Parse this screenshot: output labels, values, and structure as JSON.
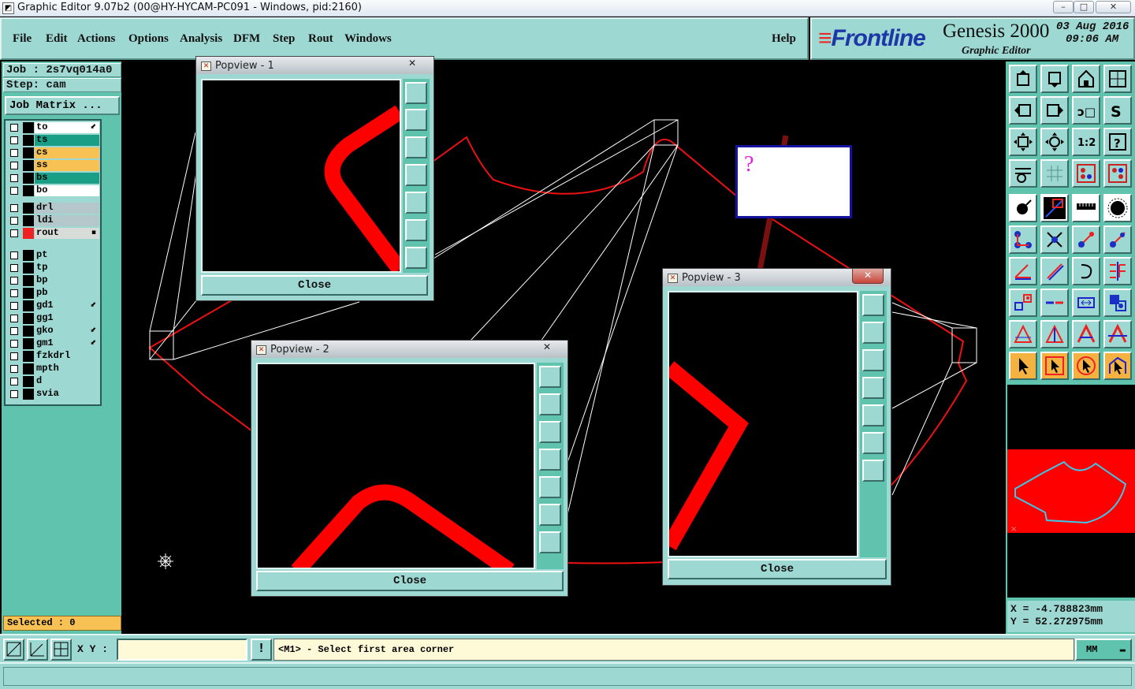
{
  "window": {
    "title": "Graphic Editor 9.07b2 (00@HY-HYCAM-PC091 - Windows, pid:2160)",
    "min": "–",
    "max": "□",
    "close": "✕"
  },
  "menu": {
    "items": [
      "File",
      "Edit",
      "Actions",
      "Options",
      "Analysis",
      "DFM",
      "Step",
      "Rout",
      "Windows"
    ],
    "help": "Help"
  },
  "brand": {
    "logo": "Frontline",
    "product": "Genesis 2000",
    "subtitle": "Graphic Editor",
    "date": "03 Aug 2016",
    "time": "09:06 AM"
  },
  "job": {
    "job_line": "Job : 2s7vq014a0",
    "step_line": "Step: cam",
    "matrix_button": "Job Matrix ..."
  },
  "layers": [
    {
      "name": "to",
      "color": "#ffffff",
      "swatch": "#000000",
      "mark": "⬋"
    },
    {
      "name": "ts",
      "color": "#1a9f86",
      "swatch": "#000000",
      "mark": ""
    },
    {
      "name": "cs",
      "color": "#f7c154",
      "swatch": "#000000",
      "mark": ""
    },
    {
      "name": "ss",
      "color": "#f7c154",
      "swatch": "#000000",
      "mark": ""
    },
    {
      "name": "bs",
      "color": "#1a9f86",
      "swatch": "#000000",
      "mark": ""
    },
    {
      "name": "bo",
      "color": "#ffffff",
      "swatch": "#000000",
      "mark": ""
    },
    {
      "name": "drl",
      "color": "#b4c8cc",
      "swatch": "#000000",
      "mark": ""
    },
    {
      "name": "ldi",
      "color": "#b4c8cc",
      "swatch": "#000000",
      "mark": ""
    },
    {
      "name": "rout",
      "color": "#d8dcd8",
      "swatch": "#ee2222",
      "mark": "▪"
    },
    {
      "name": "pt",
      "color": "#9ed8d2",
      "swatch": "#000000",
      "mark": ""
    },
    {
      "name": "tp",
      "color": "#9ed8d2",
      "swatch": "#000000",
      "mark": ""
    },
    {
      "name": "bp",
      "color": "#9ed8d2",
      "swatch": "#000000",
      "mark": ""
    },
    {
      "name": "pb",
      "color": "#9ed8d2",
      "swatch": "#000000",
      "mark": ""
    },
    {
      "name": "gd1",
      "color": "#9ed8d2",
      "swatch": "#000000",
      "mark": "⬋"
    },
    {
      "name": "gg1",
      "color": "#9ed8d2",
      "swatch": "#000000",
      "mark": ""
    },
    {
      "name": "gko",
      "color": "#9ed8d2",
      "swatch": "#000000",
      "mark": "⬋"
    },
    {
      "name": "gm1",
      "color": "#9ed8d2",
      "swatch": "#000000",
      "mark": "⬋"
    },
    {
      "name": "fzkdrl",
      "color": "#9ed8d2",
      "swatch": "#000000",
      "mark": ""
    },
    {
      "name": "mpth",
      "color": "#9ed8d2",
      "swatch": "#000000",
      "mark": ""
    },
    {
      "name": "d",
      "color": "#9ed8d2",
      "swatch": "#000000",
      "mark": ""
    },
    {
      "name": "svia",
      "color": "#9ed8d2",
      "swatch": "#000000",
      "mark": ""
    }
  ],
  "selected": "Selected : 0",
  "popviews": [
    {
      "title": "Popview - 1",
      "close_label": "Close",
      "close_x": "✕"
    },
    {
      "title": "Popview - 2",
      "close_label": "Close",
      "close_x": "✕"
    },
    {
      "title": "Popview - 3",
      "close_label": "Close",
      "close_x": "✕"
    }
  ],
  "tooltip": {
    "text": "?"
  },
  "status": {
    "xy_label": "X Y :",
    "xy_value": "",
    "warn_icon": "!",
    "message": "<M1> - Select first area corner",
    "units": "MM"
  },
  "coords": {
    "x": "X = -4.788823mm",
    "y": "Y = 52.272975mm"
  },
  "colors": {
    "accent": "#9ed8d2",
    "panel": "#5fc3ae",
    "rout": "#ee1111",
    "preview_bg": "#ff0000",
    "preview_outline": "#3ac8e8"
  }
}
